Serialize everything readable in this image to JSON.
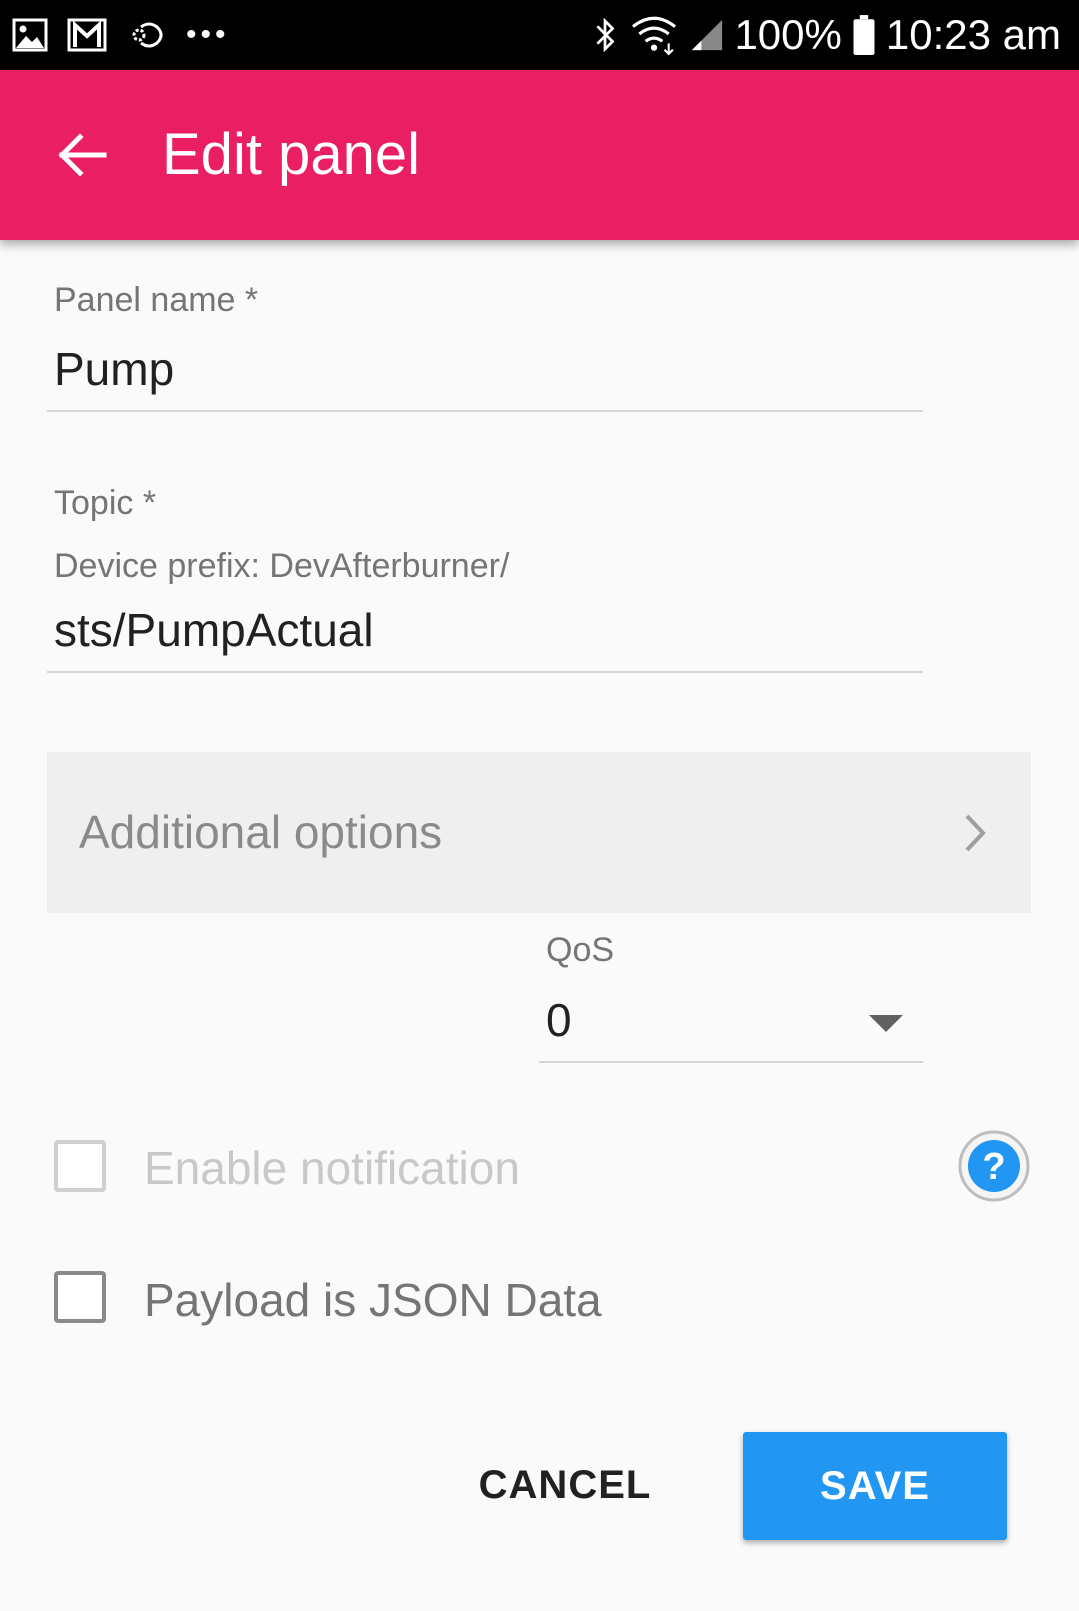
{
  "status_bar": {
    "left_icons": [
      "gallery-icon",
      "gmail-icon",
      "sync-icon",
      "more-dots-icon"
    ],
    "right_icons": [
      "bluetooth-icon",
      "wifi-icon",
      "signal-icon",
      "battery-icon"
    ],
    "dots": "•••",
    "battery": "100%",
    "time": "10:23 am"
  },
  "app_bar": {
    "title": "Edit panel",
    "color": "#e91e63"
  },
  "form": {
    "panel_name_label": "Panel name *",
    "panel_name_value": "Pump",
    "topic_label": "Topic *",
    "device_prefix": "Device prefix: DevAfterburner/",
    "topic_value": "sts/PumpActual",
    "additional_options": "Additional options",
    "qos_label": "QoS",
    "qos_value": "0",
    "enable_notification_label": "Enable notification",
    "enable_notification_checked": false,
    "enable_notification_enabled": false,
    "payload_json_label": "Payload is JSON Data",
    "payload_json_checked": false
  },
  "actions": {
    "cancel_label": "CANCEL",
    "save_label": "SAVE",
    "save_color": "#2196f3"
  }
}
